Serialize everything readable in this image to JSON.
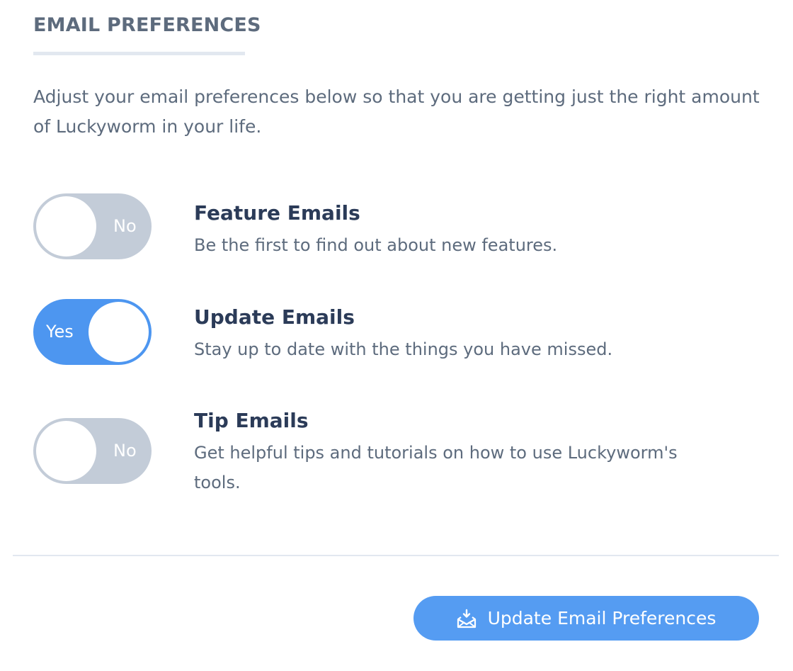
{
  "section": {
    "title": "EMAIL PREFERENCES",
    "intro": "Adjust your email preferences below so that you are getting just the right amount of Luckyworm in your life."
  },
  "preferences": [
    {
      "title": "Feature Emails",
      "description": "Be the first to find out about new features.",
      "enabled": false,
      "toggle_label": "No"
    },
    {
      "title": "Update Emails",
      "description": "Stay up to date with the things you have missed.",
      "enabled": true,
      "toggle_label": "Yes"
    },
    {
      "title": "Tip Emails",
      "description": "Get helpful tips and tutorials on how to use Luckyworm's tools.",
      "enabled": false,
      "toggle_label": "No"
    }
  ],
  "submit": {
    "label": "Update Email Preferences",
    "icon": "envelope-download-icon"
  },
  "colors": {
    "accent": "#4d96f0",
    "toggle_off": "#c3ccd8",
    "title_text": "#2b3b58",
    "body_text": "#5d6b7d"
  }
}
